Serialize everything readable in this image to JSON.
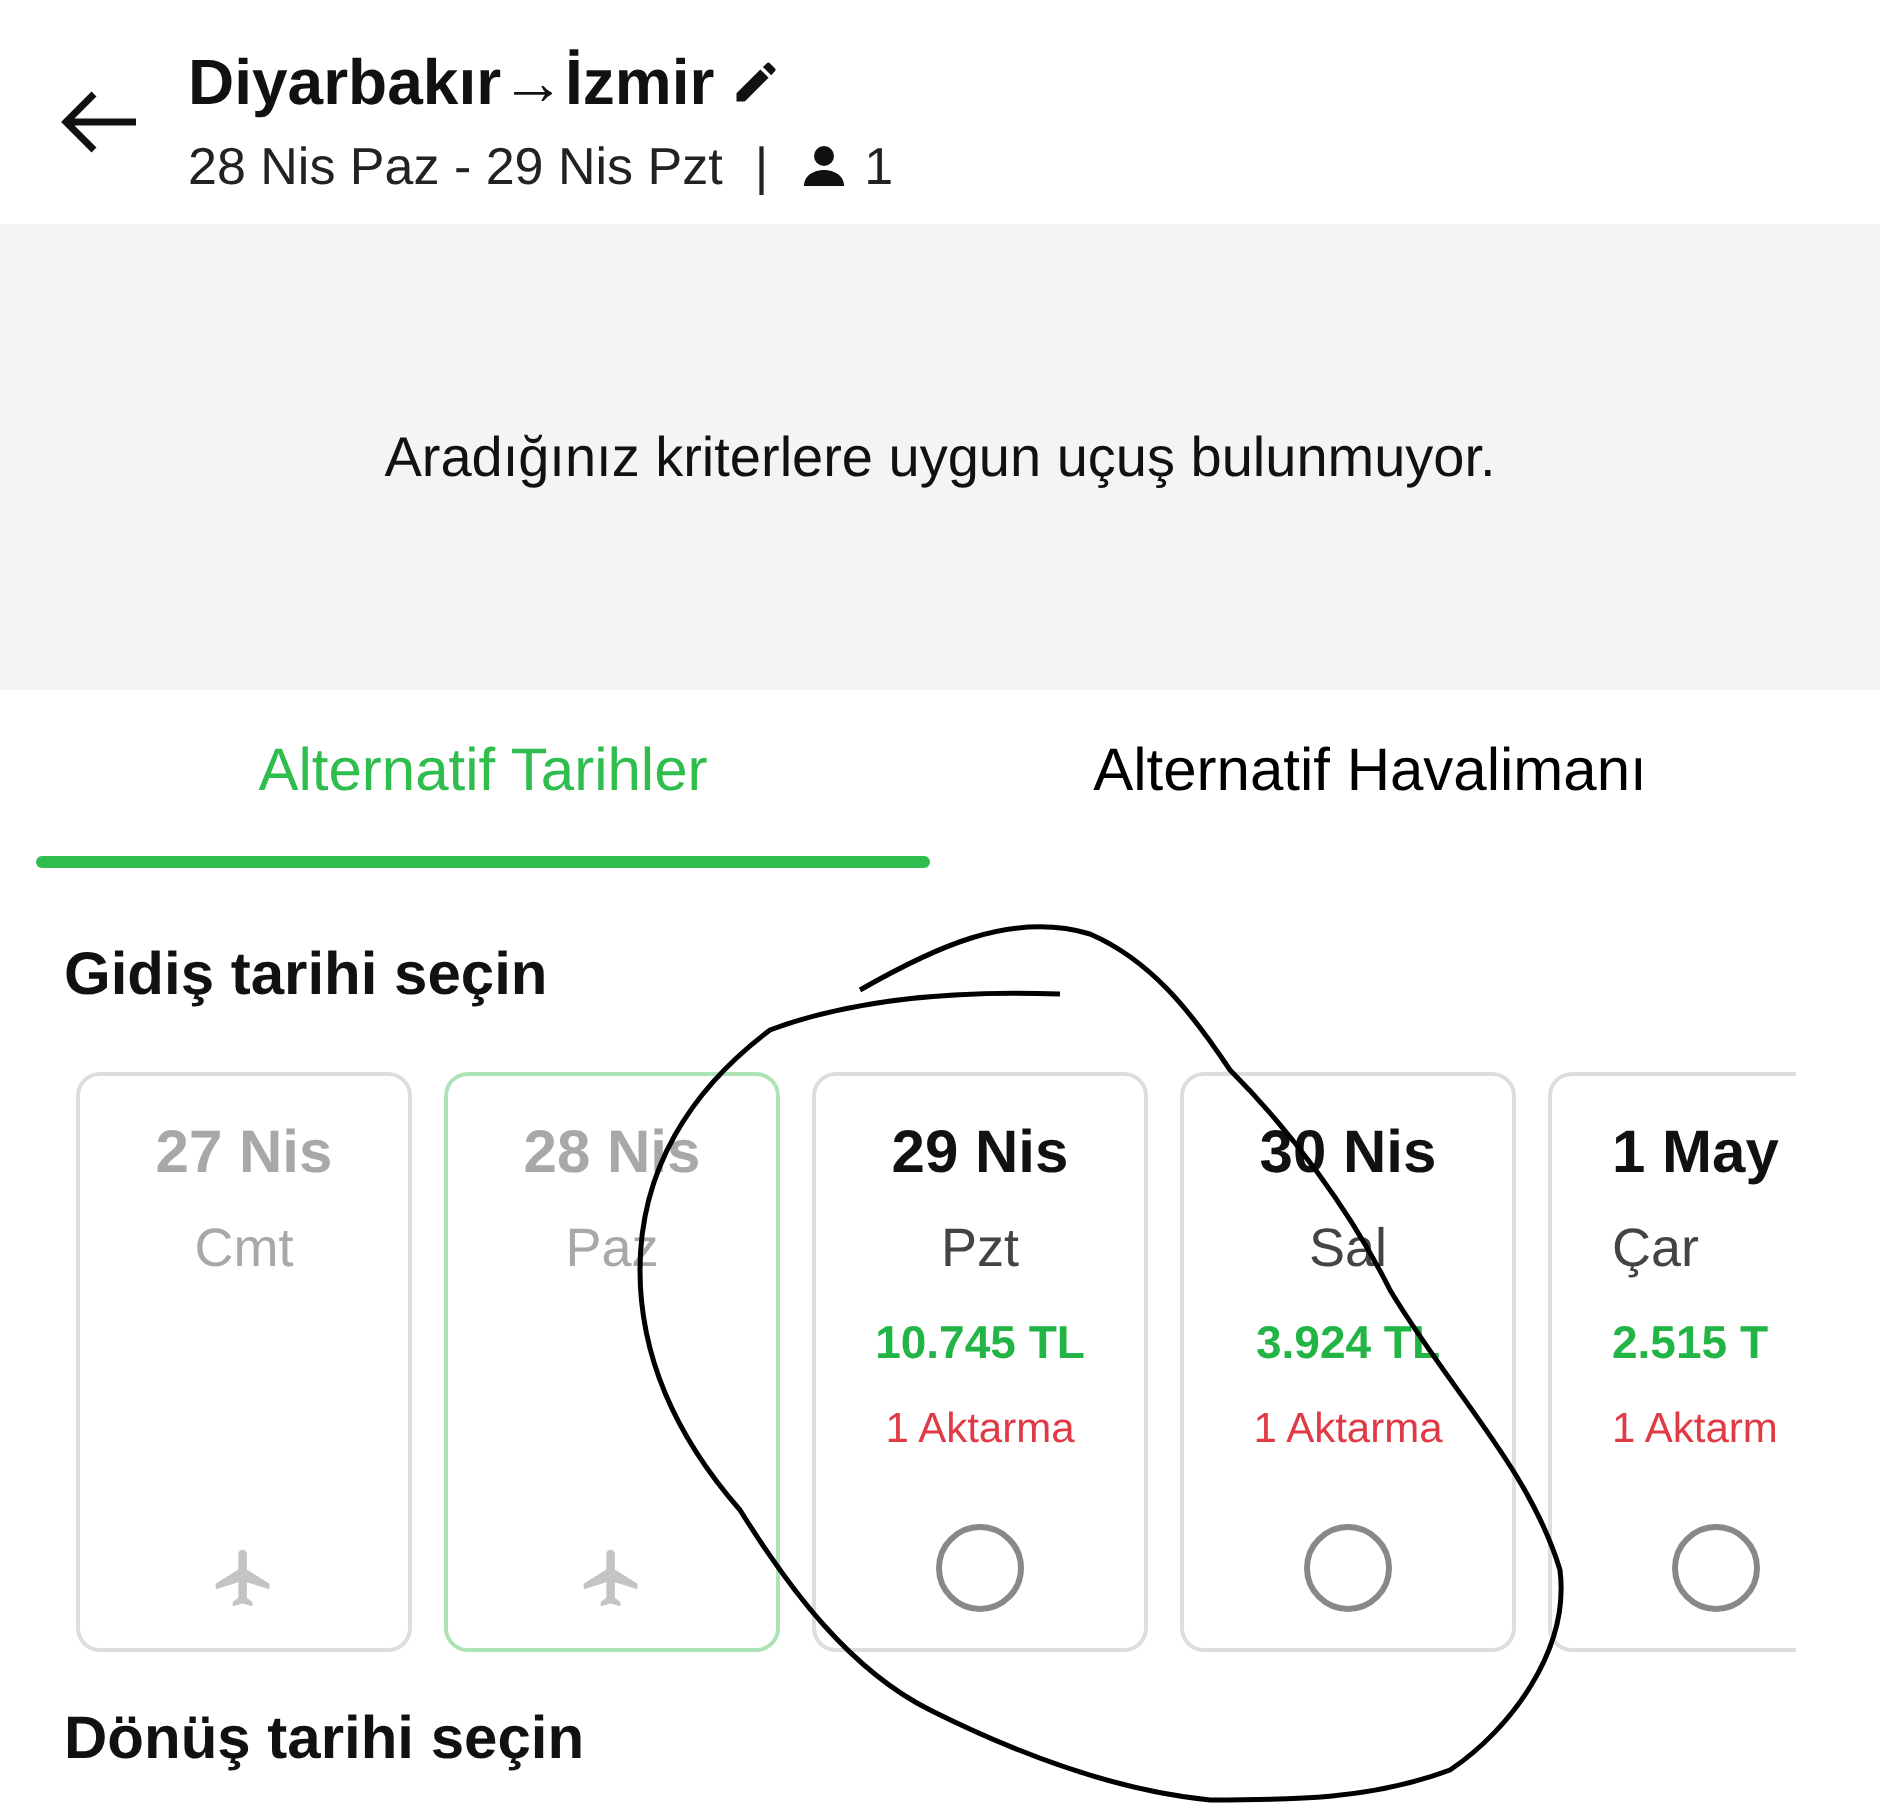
{
  "header": {
    "title": "Diyarbakır→İzmir",
    "dates": "28 Nis Paz - 29 Nis Pzt",
    "separator": "|",
    "passengers": "1"
  },
  "message": "Aradığınız kriterlere uygun uçuş bulunmuyor.",
  "tabs": [
    {
      "label": "Alternatif Tarihler",
      "selected": true
    },
    {
      "label": "Alternatif Havalimanı",
      "selected": false
    }
  ],
  "departure": {
    "heading": "Gidiş tarihi seçin",
    "days": [
      {
        "date": "27 Nis",
        "day": "Cmt",
        "disabled": true,
        "selected": false
      },
      {
        "date": "28 Nis",
        "day": "Paz",
        "disabled": true,
        "selected": true
      },
      {
        "date": "29 Nis",
        "day": "Pzt",
        "price": "10.745 TL",
        "transfers": "1 Aktarma",
        "disabled": false,
        "selected": false
      },
      {
        "date": "30 Nis",
        "day": "Sal",
        "price": "3.924 TL",
        "transfers": "1 Aktarma",
        "disabled": false,
        "selected": false
      },
      {
        "date": "1 May",
        "day": "Çar",
        "price": "2.515 T",
        "transfers": "1 Aktarm",
        "disabled": false,
        "selected": false
      }
    ]
  },
  "return": {
    "heading": "Dönüş tarihi seçin"
  }
}
